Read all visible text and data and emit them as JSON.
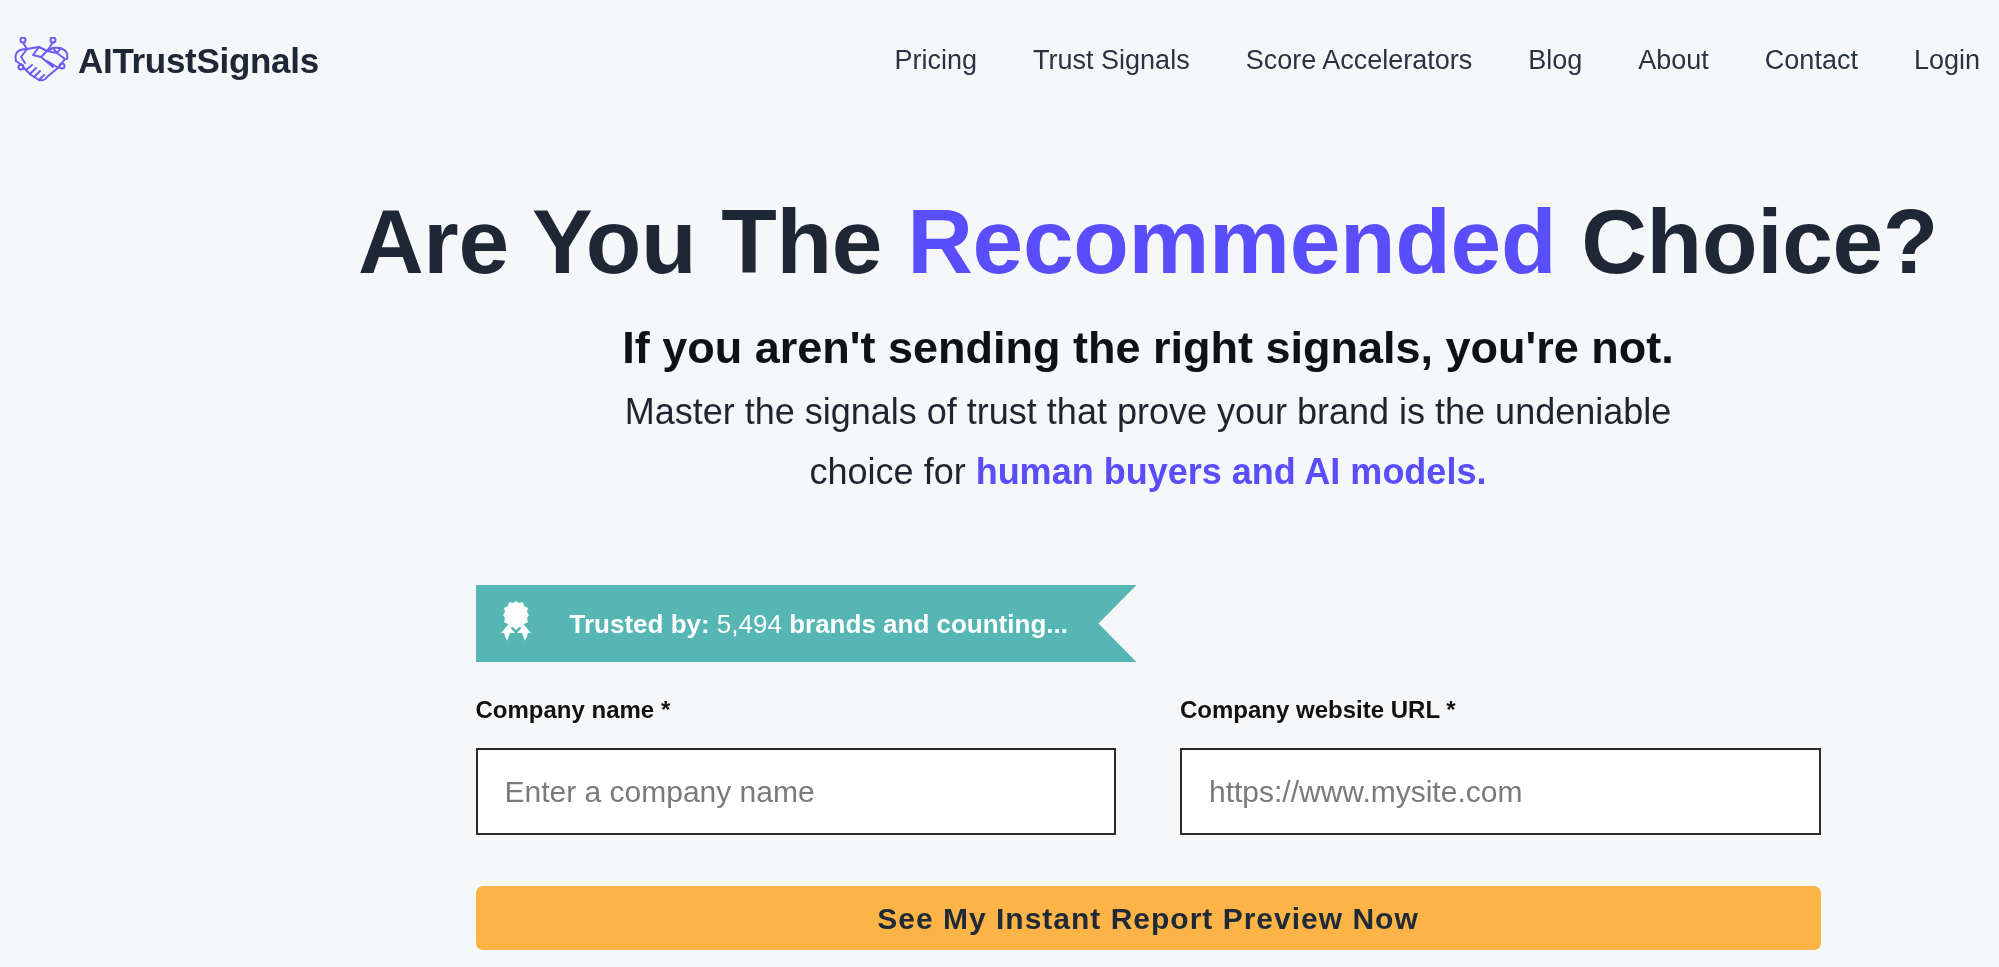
{
  "header": {
    "logo": {
      "text": "AITrustSignals"
    },
    "nav": [
      {
        "label": "Pricing"
      },
      {
        "label": "Trust Signals"
      },
      {
        "label": "Score Accelerators"
      },
      {
        "label": "Blog"
      },
      {
        "label": "About"
      },
      {
        "label": "Contact"
      },
      {
        "label": "Login"
      }
    ]
  },
  "hero": {
    "title": [
      {
        "text": "Are You The ",
        "highlight": false
      },
      {
        "text": "Recommended",
        "highlight": true
      },
      {
        "text": " Choice?",
        "highlight": false
      }
    ],
    "subtitle": "If you aren't sending the right signals, you're not.",
    "description": {
      "text": "Master the signals of trust that prove your brand is the undeniable choice for",
      "link": "human buyers and AI models."
    }
  },
  "trust_badge": {
    "text": "**Trusted by:** 5,494 **brands and counting...**"
  },
  "form": {
    "fields": [
      {
        "label": "Company name *",
        "placeholder": "Enter a company name"
      },
      {
        "label": "Company website URL *",
        "placeholder": "https://www.mysite.com"
      }
    ],
    "submit": "See My Instant Report Preview Now"
  }
}
